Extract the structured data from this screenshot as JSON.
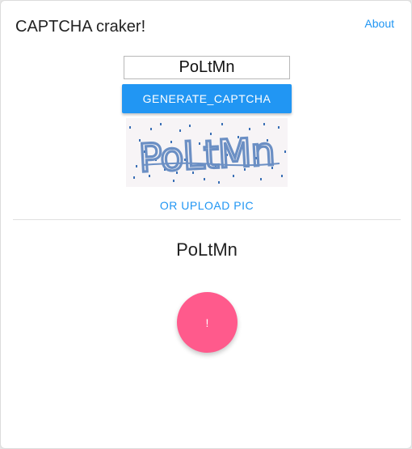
{
  "header": {
    "title": "CAPTCHA craker!",
    "about_label": "About"
  },
  "captcha": {
    "input_value": "PoLtMn",
    "generate_label": "GENERATE_CAPTCHA",
    "image_text": "PoLtMn",
    "upload_label": "OR UPLOAD PIC"
  },
  "result": {
    "text": "PoLtMn"
  },
  "fab": {
    "label": "!"
  },
  "colors": {
    "accent": "#2196f3",
    "fab": "#ff5a8c",
    "captcha_ink": "#6b8fc4",
    "captcha_noise": "#3a6fb5",
    "captcha_bg": "#f7f4f6"
  }
}
